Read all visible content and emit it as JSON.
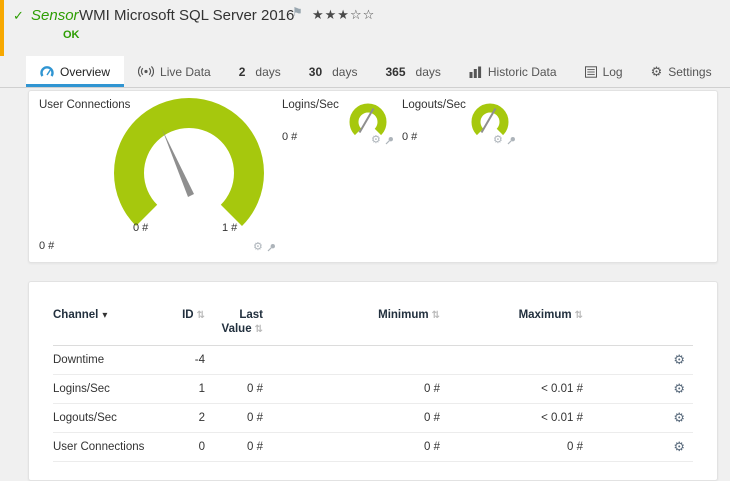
{
  "header": {
    "kind": "Sensor",
    "title": "WMI Microsoft SQL Server 2016",
    "status": "OK",
    "stars": "★★★☆☆"
  },
  "icons": {
    "check": "✓",
    "flag": "⚑",
    "gear": "⚙",
    "sort": "⇅",
    "sort_down": "▾"
  },
  "tabs": {
    "overview": "Overview",
    "live_data": "Live Data",
    "days2": {
      "num": "2",
      "word": "days"
    },
    "days30": {
      "num": "30",
      "word": "days"
    },
    "days365": {
      "num": "365",
      "word": "days"
    },
    "historic": "Historic Data",
    "log": "Log",
    "settings": "Settings"
  },
  "gauges": {
    "main": {
      "title": "User Connections",
      "value": "0 #",
      "scale_min": "0 #",
      "scale_max": "1 #"
    },
    "logins": {
      "title": "Logins/Sec",
      "value": "0 #"
    },
    "logouts": {
      "title": "Logouts/Sec",
      "value": "0 #"
    }
  },
  "table": {
    "headers": {
      "channel": "Channel",
      "id": "ID",
      "last_value": "Last Value",
      "minimum": "Minimum",
      "maximum": "Maximum"
    },
    "rows": [
      {
        "channel": "Downtime",
        "id": "-4",
        "last": "",
        "min": "",
        "max": ""
      },
      {
        "channel": "Logins/Sec",
        "id": "1",
        "last": "0 #",
        "min": "0 #",
        "max": "< 0.01 #"
      },
      {
        "channel": "Logouts/Sec",
        "id": "2",
        "last": "0 #",
        "min": "0 #",
        "max": "< 0.01 #"
      },
      {
        "channel": "User Connections",
        "id": "0",
        "last": "0 #",
        "min": "0 #",
        "max": "0 #"
      }
    ]
  },
  "colors": {
    "gauge_green": "#a6c80d",
    "status_green": "#2e9e04",
    "active_tab_blue": "#3095d2",
    "edge_orange": "#f7a800"
  }
}
